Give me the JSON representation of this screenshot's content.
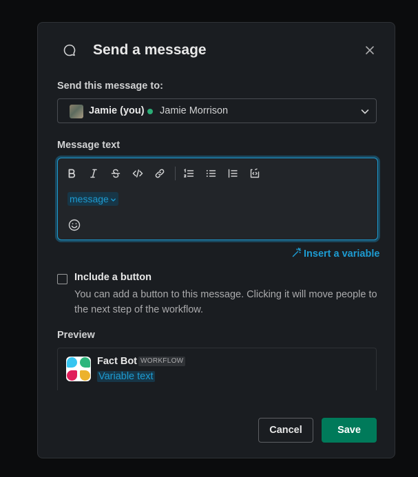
{
  "header": {
    "title": "Send a message",
    "icon": "speech-bubble-icon",
    "close_icon": "close-icon"
  },
  "recipient": {
    "label": "Send this message to:",
    "selected_you": "Jamie (you)",
    "selected_name": "Jamie Morrison",
    "presence_color": "#2bac76"
  },
  "message": {
    "label": "Message text",
    "toolbar": [
      "bold-icon",
      "italic-icon",
      "strikethrough-icon",
      "code-icon",
      "link-icon",
      "ordered-list-icon",
      "bulleted-list-icon",
      "blockquote-icon",
      "code-block-icon"
    ],
    "token": "message"
  },
  "insert_variable": {
    "label": "Insert a variable"
  },
  "include_button": {
    "label": "Include a button",
    "description": "You can add a button to this message. Clicking it will move people to the next step of the workflow.",
    "checked": false
  },
  "preview": {
    "label": "Preview",
    "bot_name": "Fact Bot",
    "badge": "WORKFLOW",
    "text": "Variable text"
  },
  "footer": {
    "cancel_label": "Cancel",
    "save_label": "Save"
  },
  "colors": {
    "accent": "#1d9bd1",
    "save": "#007a5a",
    "background": "#1a1d21"
  }
}
